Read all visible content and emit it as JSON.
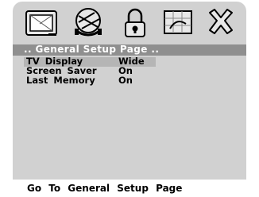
{
  "tabs": [
    {
      "icon": "tv-display-icon"
    },
    {
      "icon": "audio-disc-icon"
    },
    {
      "icon": "lock-icon"
    },
    {
      "icon": "picture-grid-icon"
    },
    {
      "icon": "close-icon"
    }
  ],
  "header": {
    "title": ".. General Setup Page .."
  },
  "settings": [
    {
      "label": "TV Display",
      "value": "Wide"
    },
    {
      "label": "Screen Saver",
      "value": "On"
    },
    {
      "label": "Last Memory",
      "value": "On"
    }
  ],
  "footer": {
    "hint": "Go To General Setup Page"
  },
  "colors": {
    "panel": "#d1d1d1",
    "header_bar": "#8f8f8f",
    "selection": "#b5b5b5",
    "icon_fill": "#e8e8e8",
    "icon_stroke": "#000000"
  }
}
